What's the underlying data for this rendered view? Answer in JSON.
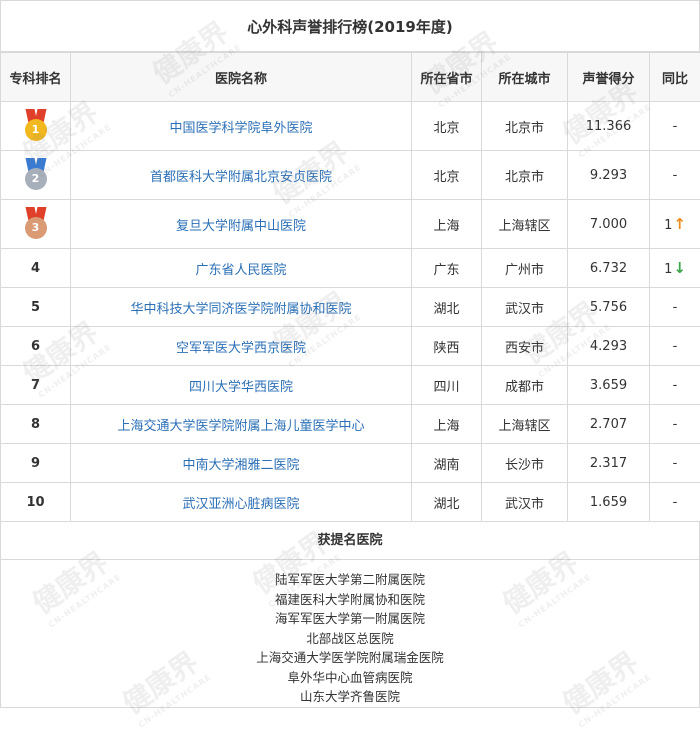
{
  "title": "心外科声誉排行榜(2019年度)",
  "headers": {
    "rank": "专科排名",
    "hospital": "医院名称",
    "province": "所在省市",
    "city": "所在城市",
    "score": "声誉得分",
    "change": "同比"
  },
  "rows": [
    {
      "rank": "1",
      "hospital": "中国医学科学院阜外医院",
      "province": "北京",
      "city": "北京市",
      "score": "11.366",
      "change": "-",
      "change_arrow": "",
      "medal": "gold"
    },
    {
      "rank": "2",
      "hospital": "首都医科大学附属北京安贞医院",
      "province": "北京",
      "city": "北京市",
      "score": "9.293",
      "change": "-",
      "change_arrow": "",
      "medal": "silver"
    },
    {
      "rank": "3",
      "hospital": "复旦大学附属中山医院",
      "province": "上海",
      "city": "上海辖区",
      "score": "7.000",
      "change": "1",
      "change_arrow": "↑",
      "medal": "bronze"
    },
    {
      "rank": "4",
      "hospital": "广东省人民医院",
      "province": "广东",
      "city": "广州市",
      "score": "6.732",
      "change": "1",
      "change_arrow": "↓",
      "medal": ""
    },
    {
      "rank": "5",
      "hospital": "华中科技大学同济医学院附属协和医院",
      "province": "湖北",
      "city": "武汉市",
      "score": "5.756",
      "change": "-",
      "change_arrow": "",
      "medal": ""
    },
    {
      "rank": "6",
      "hospital": "空军军医大学西京医院",
      "province": "陕西",
      "city": "西安市",
      "score": "4.293",
      "change": "-",
      "change_arrow": "",
      "medal": ""
    },
    {
      "rank": "7",
      "hospital": "四川大学华西医院",
      "province": "四川",
      "city": "成都市",
      "score": "3.659",
      "change": "-",
      "change_arrow": "",
      "medal": ""
    },
    {
      "rank": "8",
      "hospital": "上海交通大学医学院附属上海儿童医学中心",
      "province": "上海",
      "city": "上海辖区",
      "score": "2.707",
      "change": "-",
      "change_arrow": "",
      "medal": ""
    },
    {
      "rank": "9",
      "hospital": "中南大学湘雅二医院",
      "province": "湖南",
      "city": "长沙市",
      "score": "2.317",
      "change": "-",
      "change_arrow": "",
      "medal": ""
    },
    {
      "rank": "10",
      "hospital": "武汉亚洲心脏病医院",
      "province": "湖北",
      "city": "武汉市",
      "score": "1.659",
      "change": "-",
      "change_arrow": "",
      "medal": ""
    }
  ],
  "nominee": {
    "title": "获提名医院",
    "items": [
      "陆军军医大学第二附属医院",
      "福建医科大学附属协和医院",
      "海军军医大学第一附属医院",
      "北部战区总医院",
      "上海交通大学医学院附属瑞金医院",
      "阜外华中心血管病医院",
      "山东大学齐鲁医院"
    ]
  },
  "watermark": {
    "text": "健康界",
    "sub": "CN-HEALTHCARE"
  },
  "colors": {
    "link": "#2b6fb6",
    "up": "#f08c1a",
    "down": "#3aa64a",
    "gold": "#f2b81f",
    "silver": "#a7afbb",
    "bronze": "#d99a74",
    "border": "#d9d9d9"
  }
}
